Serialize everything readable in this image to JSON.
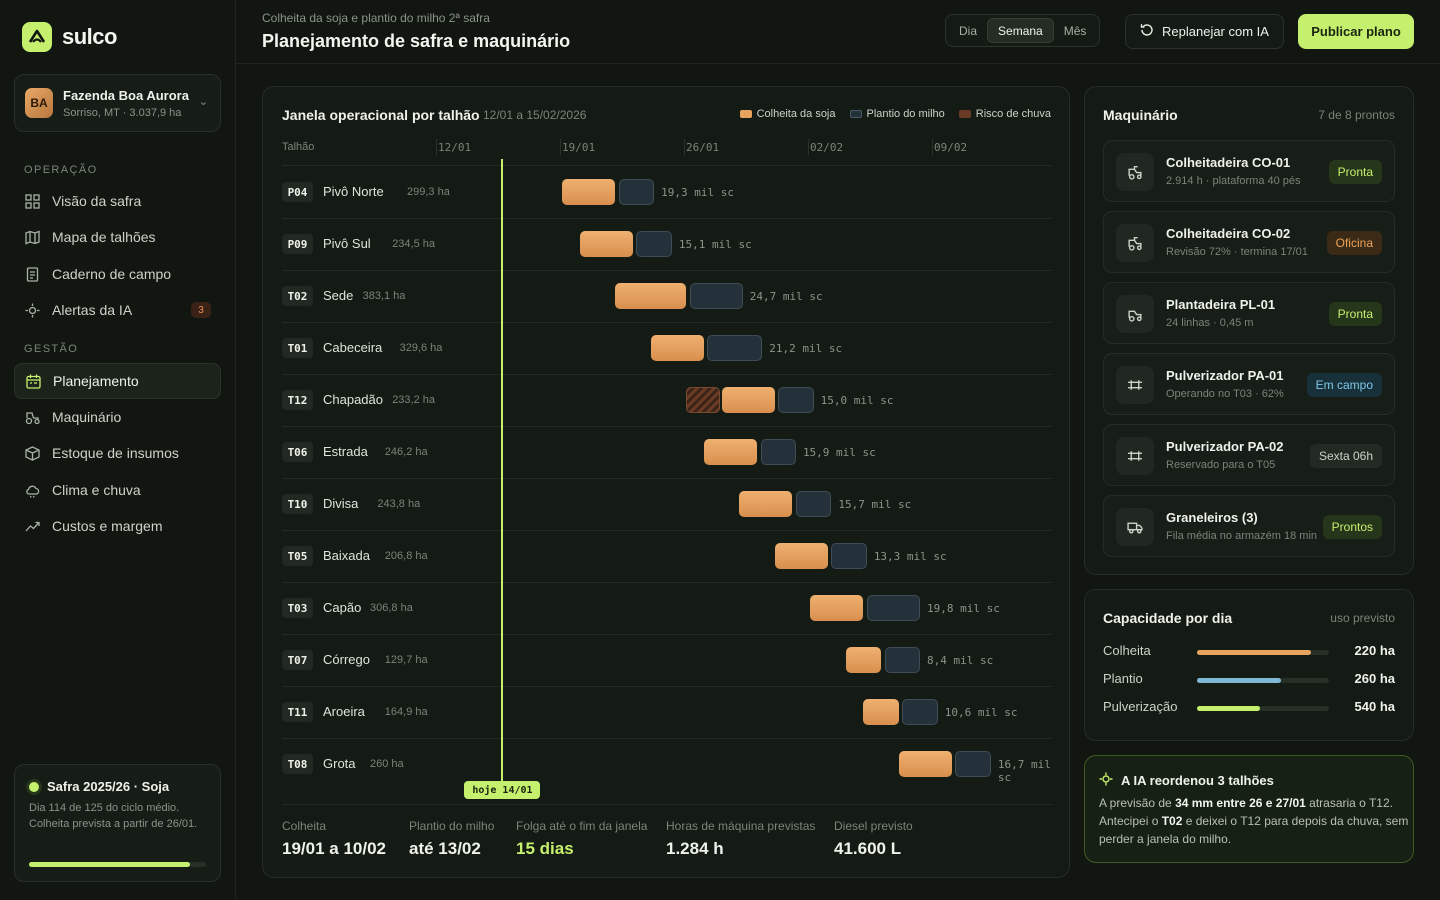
{
  "brand": {
    "name": "sulco"
  },
  "farm": {
    "initials": "BA",
    "name": "Fazenda Boa Aurora",
    "sub": "Sorriso, MT · 3.037,9 ha"
  },
  "nav": {
    "section_ops": "OPERAÇÃO",
    "section_mgmt": "GESTÃO",
    "items": [
      {
        "label": "Visão da safra",
        "icon": "grid-icon"
      },
      {
        "label": "Mapa de talhões",
        "icon": "map-icon"
      },
      {
        "label": "Caderno de campo",
        "icon": "notebook-icon"
      },
      {
        "label": "Alertas da IA",
        "icon": "ai-alert-icon",
        "badge": "3"
      },
      {
        "label": "Planejamento",
        "icon": "calendar-icon",
        "active": true
      },
      {
        "label": "Maquinário",
        "icon": "tractor-icon"
      },
      {
        "label": "Estoque de insumos",
        "icon": "box-icon"
      },
      {
        "label": "Clima e chuva",
        "icon": "cloud-icon"
      },
      {
        "label": "Custos e margem",
        "icon": "trend-icon"
      }
    ]
  },
  "season": {
    "title": "Safra 2025/26 · Soja",
    "text": "Dia 114 de 125 do ciclo médio. Colheita prevista a partir de 26/01.",
    "progress": 0.912
  },
  "header": {
    "subtitle": "Colheita da soja e plantio do milho 2ª safra",
    "title": "Planejamento de safra e maquinário",
    "views": [
      "Dia",
      "Semana",
      "Mês"
    ],
    "active_view": "Semana",
    "replan": "Replanejar com IA",
    "publish": "Publicar plano"
  },
  "gantt": {
    "title": "Janela operacional por talhão",
    "range": "12/01 a 15/02/2026",
    "legend": [
      {
        "label": "Colheita da soja",
        "color": "#e8a35e"
      },
      {
        "label": "Plantio do milho",
        "color": "#3e4c55"
      },
      {
        "label": "Risco de chuva",
        "color": "#6a3b24"
      }
    ],
    "col_field": "Talhão",
    "dates": [
      "12/01",
      "19/01",
      "26/01",
      "02/02",
      "09/02"
    ],
    "today": "hoje 14/01",
    "rows": [
      {
        "code": "P04",
        "name": "Pivô Norte",
        "ha": "299,3 ha",
        "yield": "19,3 mil sc",
        "harvest": [
          19.0,
          22.0
        ],
        "plant": [
          22.2,
          24.2
        ]
      },
      {
        "code": "P09",
        "name": "Pivô Sul",
        "ha": "234,5 ha",
        "yield": "15,1 mil sc",
        "harvest": [
          20.0,
          23.0
        ],
        "plant": [
          23.2,
          25.2
        ]
      },
      {
        "code": "T02",
        "name": "Sede",
        "ha": "383,1 ha",
        "yield": "24,7 mil sc",
        "harvest": [
          22.0,
          26.0
        ],
        "plant": [
          26.2,
          29.2
        ]
      },
      {
        "code": "T01",
        "name": "Cabeceira",
        "ha": "329,6 ha",
        "yield": "21,2 mil sc",
        "harvest": [
          24.0,
          27.0
        ],
        "plant": [
          27.2,
          30.3
        ]
      },
      {
        "code": "T12",
        "name": "Chapadão",
        "ha": "233,2 ha",
        "yield": "15,0 mil sc",
        "risk": [
          26.0,
          28.0
        ],
        "harvest": [
          28.0,
          31.0
        ],
        "plant": [
          31.2,
          33.2
        ]
      },
      {
        "code": "T06",
        "name": "Estrada",
        "ha": "246,2 ha",
        "yield": "15,9 mil sc",
        "harvest": [
          27.0,
          30.0
        ],
        "plant": [
          30.2,
          32.2
        ]
      },
      {
        "code": "T10",
        "name": "Divisa",
        "ha": "243,8 ha",
        "yield": "15,7 mil sc",
        "harvest": [
          29.0,
          32.0
        ],
        "plant": [
          32.2,
          34.2
        ]
      },
      {
        "code": "T05",
        "name": "Baixada",
        "ha": "206,8 ha",
        "yield": "13,3 mil sc",
        "harvest": [
          31.0,
          34.0
        ],
        "plant": [
          34.2,
          36.2
        ]
      },
      {
        "code": "T03",
        "name": "Capão",
        "ha": "306,8 ha",
        "yield": "19,8 mil sc",
        "harvest": [
          33.0,
          36.0
        ],
        "plant": [
          36.2,
          39.2
        ]
      },
      {
        "code": "T07",
        "name": "Córrego",
        "ha": "129,7 ha",
        "yield": "8,4 mil sc",
        "harvest": [
          35.0,
          37.0
        ],
        "plant": [
          37.2,
          39.2
        ]
      },
      {
        "code": "T11",
        "name": "Aroeira",
        "ha": "164,9 ha",
        "yield": "10,6 mil sc",
        "harvest": [
          36.0,
          38.0
        ],
        "plant": [
          38.2,
          40.2
        ]
      },
      {
        "code": "T08",
        "name": "Grota",
        "ha": "260 ha",
        "yield": "16,7 mil sc",
        "harvest": [
          38.0,
          41.0
        ],
        "plant": [
          41.2,
          43.2
        ]
      }
    ],
    "stats": [
      {
        "label": "Colheita",
        "value": "19/01 a 10/02"
      },
      {
        "label": "Plantio do milho",
        "value": "até 13/02"
      },
      {
        "label": "Folga até o fim da janela",
        "value": "15 dias",
        "accent": true
      },
      {
        "label": "Horas de máquina previstas",
        "value": "1.284 h"
      },
      {
        "label": "Diesel previsto",
        "value": "41.600 L"
      }
    ]
  },
  "machines": {
    "title": "Maquinário",
    "meta": "7 de 8 prontos",
    "items": [
      {
        "name": "Colheitadeira CO-01",
        "sub": "2.914 h · plataforma 40 pés",
        "status": "Pronta",
        "icon": "harvester-icon",
        "tone": "green"
      },
      {
        "name": "Colheitadeira CO-02",
        "sub": "Revisão 72% · termina 17/01",
        "status": "Oficina",
        "icon": "harvester-icon",
        "tone": "orange"
      },
      {
        "name": "Plantadeira PL-01",
        "sub": "24 linhas · 0,45 m",
        "status": "Pronta",
        "icon": "planter-icon",
        "tone": "green"
      },
      {
        "name": "Pulverizador PA-01",
        "sub": "Operando no T03 · 62%",
        "status": "Em campo",
        "icon": "sprayer-icon",
        "tone": "blue"
      },
      {
        "name": "Pulverizador PA-02",
        "sub": "Reservado para o T05",
        "status": "Sexta 06h",
        "icon": "sprayer-icon",
        "tone": "gray"
      },
      {
        "name": "Graneleiros (3)",
        "sub": "Fila média no armazém 18 min",
        "status": "Prontos",
        "icon": "truck-icon",
        "tone": "green"
      }
    ]
  },
  "capacity": {
    "title": "Capacidade por dia",
    "meta": "uso previsto",
    "rows": [
      {
        "label": "Colheita",
        "value": "220 ha",
        "usage": 0.86,
        "color": "#e8a35e"
      },
      {
        "label": "Plantio",
        "value": "260 ha",
        "usage": 0.64,
        "color": "#7fb8d6"
      },
      {
        "label": "Pulverização",
        "value": "540 ha",
        "usage": 0.48,
        "color": "#c5f06e"
      }
    ]
  },
  "ai": {
    "title": "A IA reordenou 3 talhões",
    "parts": [
      "A previsão de ",
      "34 mm entre 26 e 27/01",
      " atrasaria o T12. Antecipei o ",
      "T02",
      " e deixei o T12 para depois da chuva, sem perder a janela do milho."
    ]
  }
}
